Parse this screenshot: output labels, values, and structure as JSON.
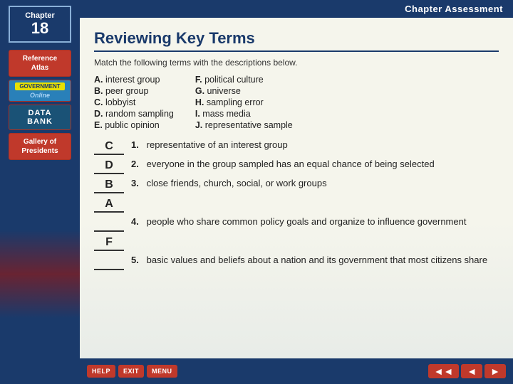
{
  "header": {
    "chapter_label": "Chapter",
    "chapter_number": "18",
    "top_bar_title": "Chapter Assessment"
  },
  "sidebar": {
    "nav_items": [
      {
        "id": "reference-atlas",
        "label": "Reference\nAtlas"
      },
      {
        "id": "gov-online",
        "label": "Government\nOnline"
      },
      {
        "id": "data-bank",
        "label": "DATA\nBANK"
      },
      {
        "id": "gallery",
        "label": "Gallery of\nPresidents"
      }
    ]
  },
  "page": {
    "title": "Reviewing Key Terms",
    "instructions": "Match the following terms with the descriptions below.",
    "terms": [
      {
        "letter": "A.",
        "text": "interest group"
      },
      {
        "letter": "B.",
        "text": "peer group"
      },
      {
        "letter": "C.",
        "text": "lobbyist"
      },
      {
        "letter": "D.",
        "text": "random sampling"
      },
      {
        "letter": "E.",
        "text": "public opinion"
      },
      {
        "letter": "F.",
        "text": "political culture"
      },
      {
        "letter": "G.",
        "text": "universe"
      },
      {
        "letter": "H.",
        "text": "sampling error"
      },
      {
        "letter": "I.",
        "text": "mass media"
      },
      {
        "letter": "J.",
        "text": "representative sample"
      }
    ],
    "questions": [
      {
        "answer": "C",
        "number": "1.",
        "text": "representative of an interest group"
      },
      {
        "answer": "D",
        "number": "2.",
        "text": "everyone in the group sampled has an equal chance of being selected"
      },
      {
        "answer": "B",
        "number": "3.",
        "text": "close friends, church, social, or work groups"
      },
      {
        "answer": "A",
        "number": "",
        "text": ""
      },
      {
        "answer": "___",
        "number": "4.",
        "text": "people who share common policy goals and organize to influence government"
      },
      {
        "answer": "F",
        "number": "",
        "text": ""
      },
      {
        "answer": "___",
        "number": "5.",
        "text": "basic values and beliefs about a nation and its government that most citizens share"
      }
    ]
  },
  "bottom_buttons": [
    {
      "label": "HELP"
    },
    {
      "label": "EXIT"
    },
    {
      "label": "MENU"
    }
  ],
  "nav_arrows": [
    {
      "label": "◄◄"
    },
    {
      "label": "◄"
    },
    {
      "label": "►"
    }
  ]
}
